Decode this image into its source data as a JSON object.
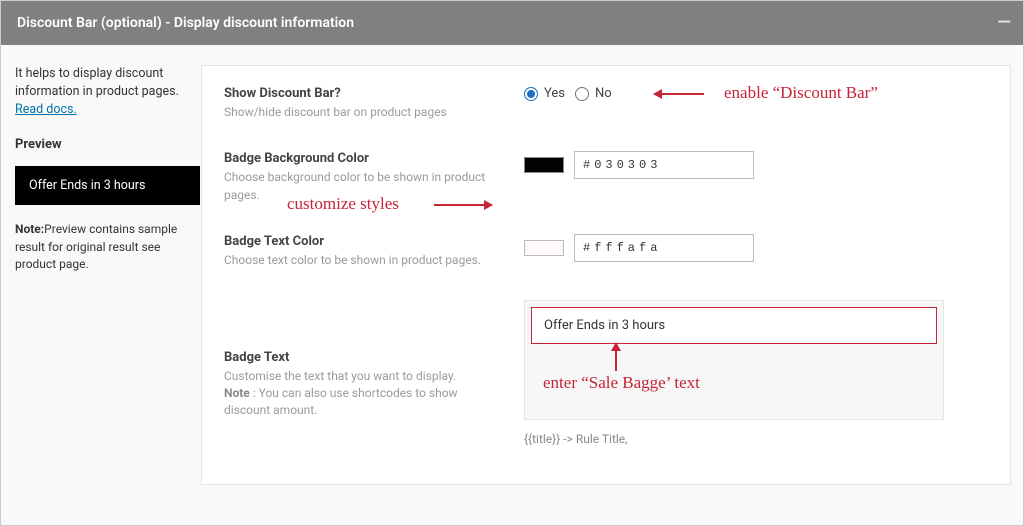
{
  "header": {
    "title": "Discount Bar (optional) - Display discount information"
  },
  "sidebar": {
    "intro_text": "It helps to display discount information in product pages. ",
    "read_docs_link": "Read docs.",
    "preview_heading": "Preview",
    "preview_badge_text": "Offer Ends in 3 hours",
    "note_bold": "Note:",
    "note_text": "Preview contains sample result for original result see product page."
  },
  "form": {
    "show_bar": {
      "label": "Show Discount Bar?",
      "desc": "Show/hide discount bar on product pages",
      "yes": "Yes",
      "no": "No",
      "selected": "yes"
    },
    "bg_color": {
      "label": "Badge Background Color",
      "desc": "Choose background color to be shown in product pages.",
      "value": "#030303",
      "swatch": "#030303"
    },
    "text_color": {
      "label": "Badge Text Color",
      "desc": "Choose text color to be shown in product pages.",
      "value": "#fffafa",
      "swatch": "#fffafa"
    },
    "badge_text": {
      "label": "Badge Text",
      "desc_line1": "Customise the text that you want to display.",
      "note_bold": "Note",
      "desc_line2": " : You can also use shortcodes to show discount amount.",
      "value": "Offer Ends in 3 hours",
      "shortcode_hint": "{{title}} -> Rule Title,"
    }
  },
  "annotations": {
    "enable": "enable “Discount Bar”",
    "styles": "customize styles",
    "sale": "enter “Sale Bagge’ text"
  }
}
